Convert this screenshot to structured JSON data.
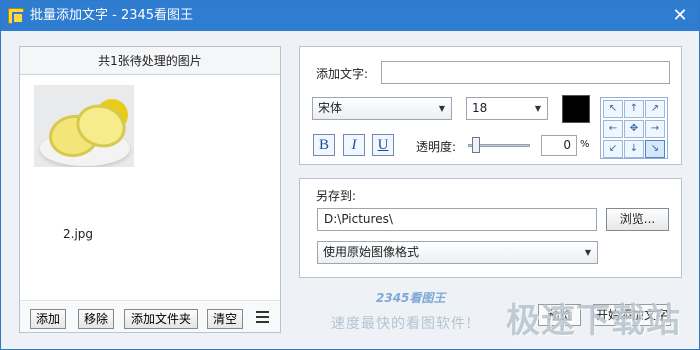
{
  "window": {
    "title": "批量添加文字 - 2345看图王",
    "close_label": "✕",
    "app_icon": "app-logo-icon",
    "close_icon": "close-icon"
  },
  "left": {
    "header": "共1张待处理的图片",
    "images": [
      {
        "filename": "2.jpg",
        "thumbnail_icon": "lemon-image-thumbnail"
      }
    ],
    "buttons": {
      "add": "添加",
      "remove": "移除",
      "add_folder": "添加文件夹",
      "clear": "清空"
    },
    "menu_icon": "list-menu-icon"
  },
  "text_panel": {
    "text_label": "添加文字:",
    "text_value": "",
    "font_value": "宋体",
    "size_value": "18",
    "color": "#000000",
    "bold_label": "B",
    "italic_label": "I",
    "underline_label": "U",
    "opacity_label": "透明度:",
    "opacity_value": "0",
    "percent_label": "%",
    "position_grid": [
      "↖",
      "↑",
      "↗",
      "←",
      "✥",
      "→",
      "↙",
      "↓",
      "↘"
    ],
    "selected_position": "↘"
  },
  "save_panel": {
    "save_to_label": "另存到:",
    "path_value": "D:\\Pictures\\",
    "browse_label": "浏览...",
    "format_value": "使用原始图像格式"
  },
  "footer": {
    "brand": "2345看图王",
    "slogan": "速度最快的看图软件!",
    "watermark": "极速下载站",
    "preview_label": "预览",
    "start_label": "开始添加文字"
  },
  "colors": {
    "titlebar": "#2f7dd1",
    "accent": "#2f79c6",
    "background": "#eef2f6"
  }
}
